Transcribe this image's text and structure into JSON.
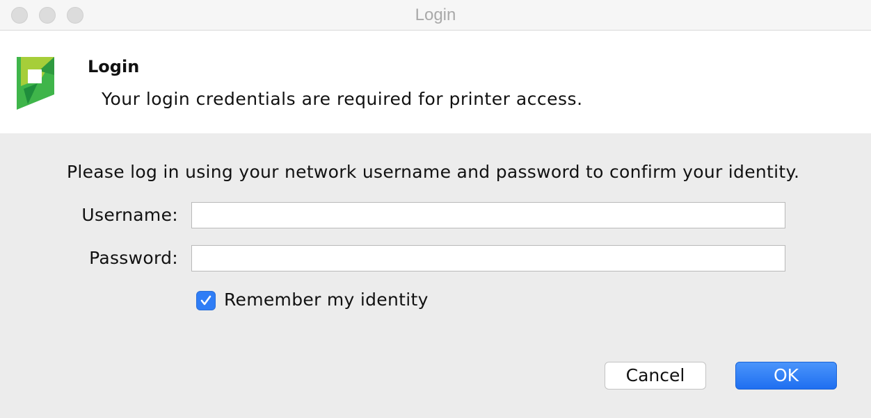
{
  "window": {
    "title": "Login"
  },
  "header": {
    "logo_icon": "papercut-logo-icon",
    "title": "Login",
    "subtitle": "Your login credentials are required for printer access."
  },
  "form": {
    "instructions": "Please log in using your network username and password to confirm your identity.",
    "username_label": "Username:",
    "username_value": "",
    "password_label": "Password:",
    "password_value": "",
    "remember_label": "Remember my identity",
    "remember_checked": true
  },
  "buttons": {
    "cancel_label": "Cancel",
    "ok_label": "OK"
  },
  "colors": {
    "accent": "#2f7df6",
    "logo_green": "#3fb54a",
    "logo_lime": "#a6ce39"
  }
}
